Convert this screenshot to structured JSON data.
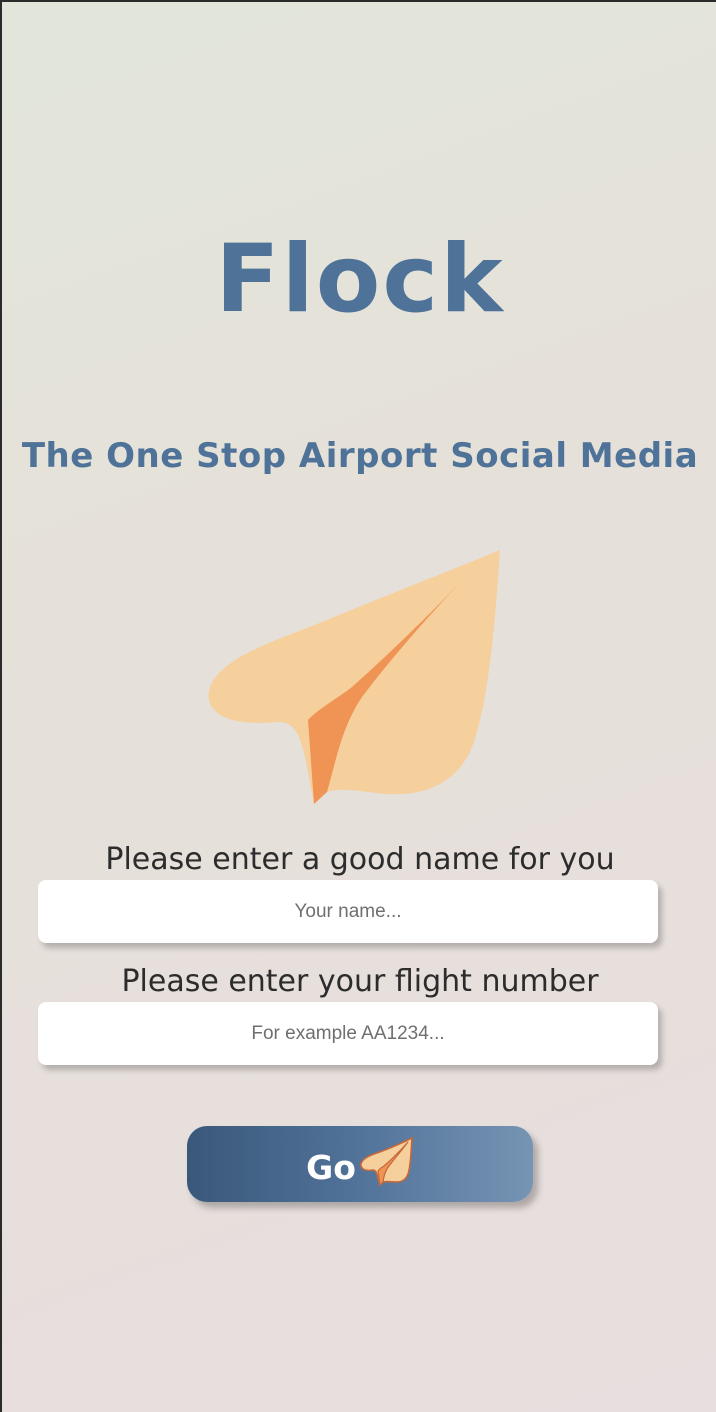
{
  "app": {
    "title": "Flock",
    "tagline": "The One Stop Airport Social Media"
  },
  "form": {
    "name_label": "Please enter a good name for you",
    "name_placeholder": "Your name...",
    "name_value": "",
    "flight_label": "Please enter your flight number",
    "flight_placeholder": "For example AA1234...",
    "flight_value": "",
    "submit_label": "Go"
  },
  "icons": {
    "logo": "paper-plane-icon",
    "submit": "paper-plane-icon"
  },
  "colors": {
    "brand_blue": "#4e7298",
    "plane_light": "#f6d09c",
    "plane_dark": "#ef9455",
    "button_start": "#39587a",
    "button_end": "#7694b3"
  }
}
